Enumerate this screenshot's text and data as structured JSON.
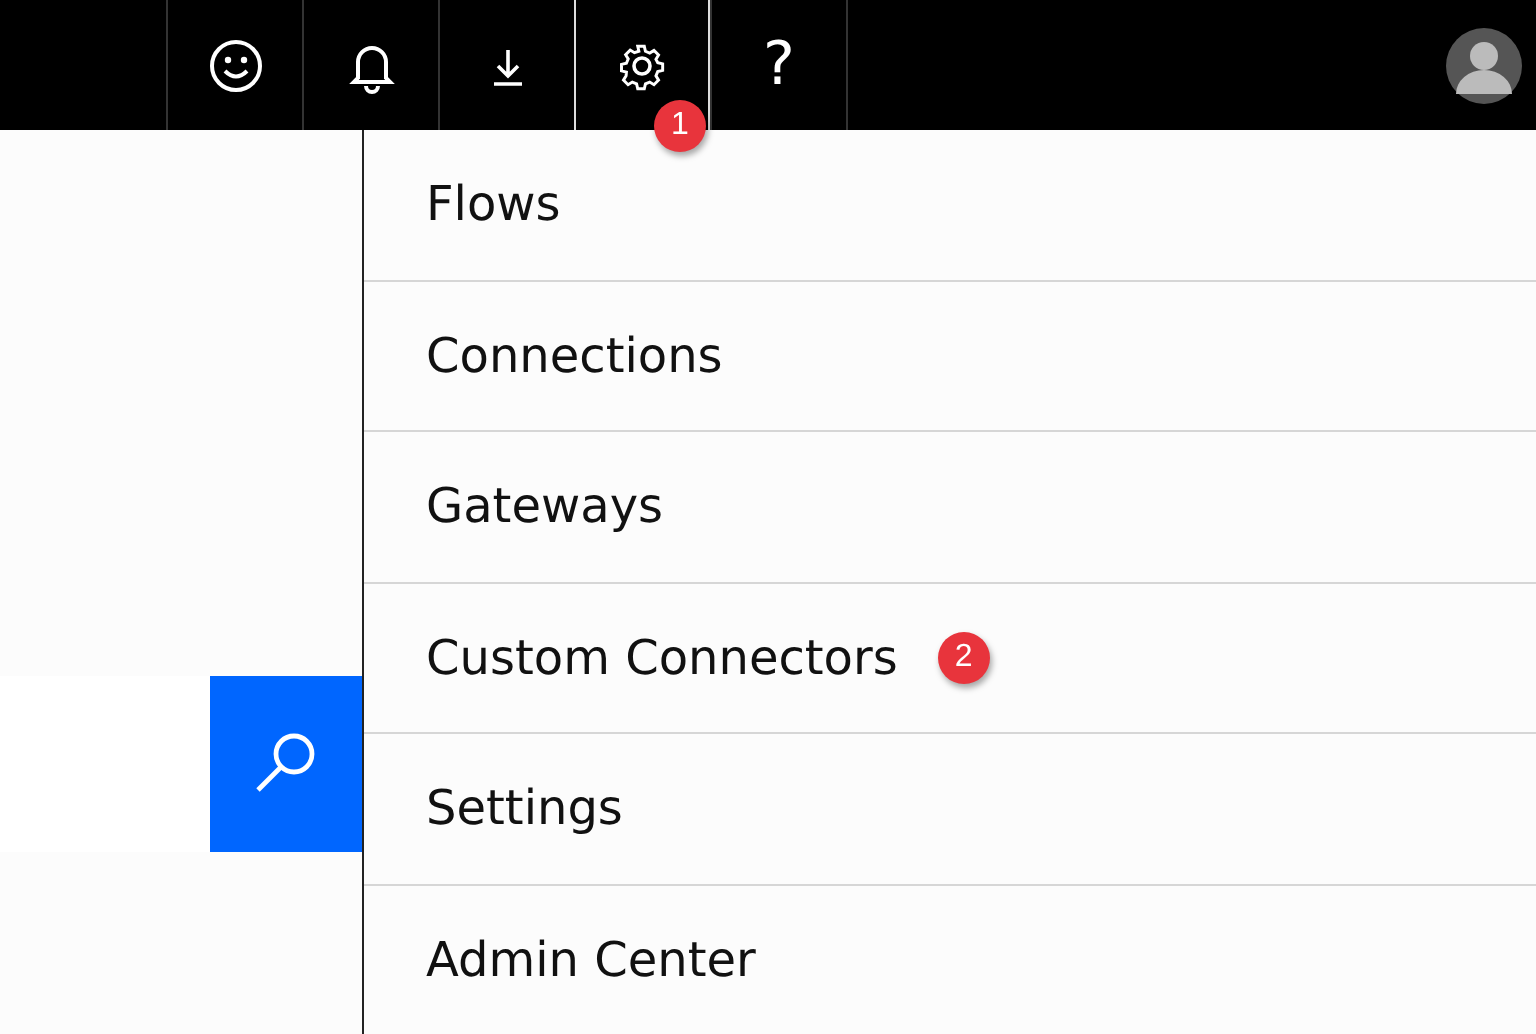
{
  "topbar": {
    "buttons": [
      {
        "kind": "smiley",
        "selected": false
      },
      {
        "kind": "bell",
        "selected": false
      },
      {
        "kind": "download",
        "selected": false
      },
      {
        "kind": "gear",
        "selected": true,
        "callout": "1"
      },
      {
        "kind": "help",
        "label": "?",
        "selected": false
      }
    ]
  },
  "search": {
    "kind": "search"
  },
  "menu": {
    "items": [
      {
        "label": "Flows"
      },
      {
        "label": "Connections"
      },
      {
        "label": "Gateways"
      },
      {
        "label": "Custom Connectors",
        "callout": "2"
      },
      {
        "label": "Settings"
      },
      {
        "label": "Admin Center"
      }
    ]
  }
}
